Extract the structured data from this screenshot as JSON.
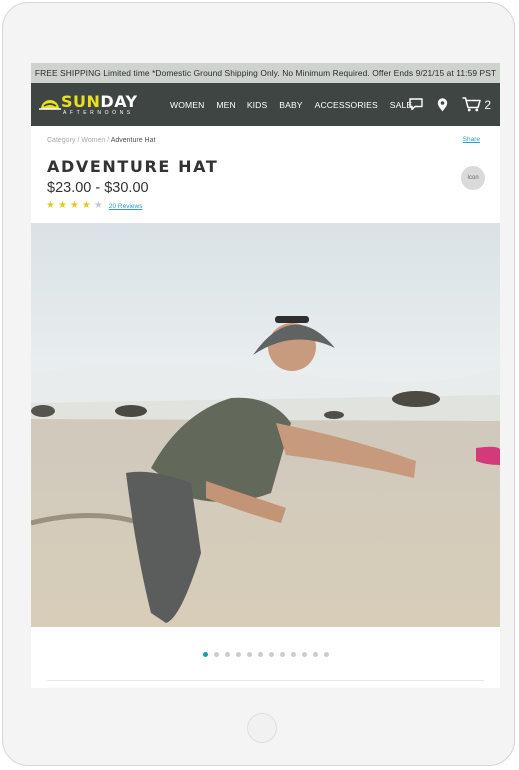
{
  "promo": {
    "text": "FREE SHIPPING Limited time *Domestic Ground Shipping Only. No Minimum Required. Offer Ends 9/21/15 at 11:59 PST"
  },
  "brand": {
    "word_part1": "SUN",
    "word_part2": "DAY",
    "subline": "AFTERNOONS",
    "accent_color": "#e8e21c",
    "nav_bg": "#3f4543"
  },
  "nav": {
    "items": [
      "WOMEN",
      "MEN",
      "KIDS",
      "BABY",
      "ACCESSORIES",
      "SALE"
    ],
    "icons": [
      "chat-icon",
      "location-pin-icon",
      "cart-icon"
    ],
    "cart_count": "2"
  },
  "breadcrumb": {
    "prefix": "Category / Women / ",
    "current": "Adventure Hat"
  },
  "share_label": "Share",
  "product": {
    "title": "ADVENTURE HAT",
    "price": "$23.00 - $30.00",
    "rating": 4,
    "rating_max": 5,
    "reviews_label": "20 Reviews",
    "icon_label": "Icon"
  },
  "gallery": {
    "slides": 12,
    "active_index": 0,
    "active_color": "#1a9bb5"
  }
}
